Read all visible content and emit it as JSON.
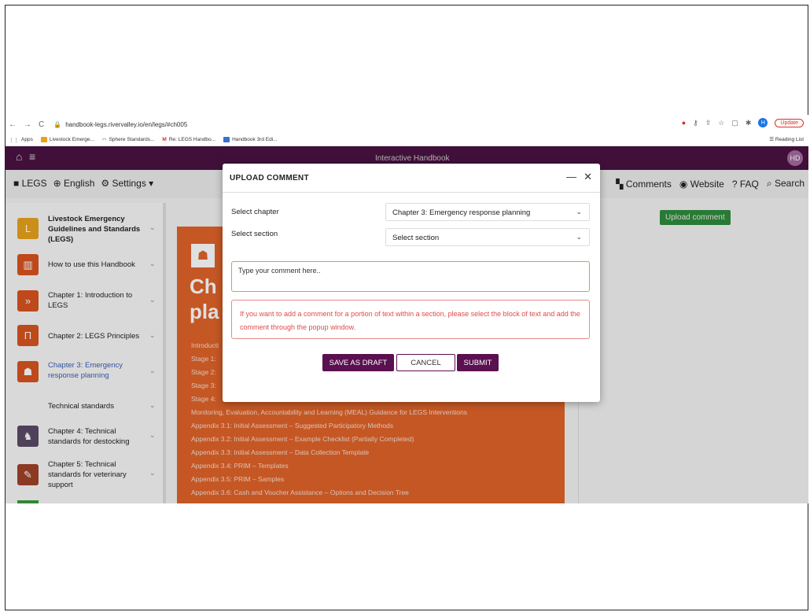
{
  "browser": {
    "url": "handbook-legs.rivervalley.io/en/legs/#ch005",
    "profile_initial": "H",
    "update_label": "Update",
    "bookmarks": [
      "Apps",
      "Livestock Emerge...",
      "Sphere Standards...",
      "Re: LEGS Handbo...",
      "Handbook 3rd Edi..."
    ],
    "reading_list": "Reading List"
  },
  "app": {
    "header_title": "Interactive Handbook",
    "user_initials": "HD",
    "toolbar_left": {
      "legs": "LEGS",
      "language": "English",
      "settings": "Settings"
    },
    "toolbar_right": {
      "comments": "Comments",
      "website": "Website",
      "faq": "FAQ",
      "search": "Search"
    },
    "upload_comment_button": "Upload comment"
  },
  "sidebar": {
    "items": [
      {
        "label": "Livestock Emergency Guidelines and Standards (LEGS)",
        "color": "#e8a21c",
        "bold": true
      },
      {
        "label": "How to use this Handbook",
        "color": "#d9541f"
      },
      {
        "label": "Chapter 1: Introduction to LEGS",
        "color": "#d9541f"
      },
      {
        "label": "Chapter 2: LEGS Principles",
        "color": "#d9541f"
      },
      {
        "label": "Chapter 3: Emergency response planning",
        "color": "#d9541f",
        "active": true
      },
      {
        "label": "Technical standards"
      },
      {
        "label": "Chapter 4: Technical standards for destocking",
        "color": "#5a4a66"
      },
      {
        "label": "Chapter 5: Technical standards for veterinary support",
        "color": "#a0432a"
      }
    ]
  },
  "content": {
    "heading_line1": "Ch",
    "heading_line2": "pla",
    "toc": [
      "Introducti",
      "Stage 1: ",
      "Stage 2: ",
      "Stage 3: ",
      "Stage 4: ",
      "Monitoring, Evaluation, Accountability and Learning (MEAL) Guidance for LEGS Interventions",
      "Appendix 3.1: Initial Assessment – Suggested Participatory Methods",
      "Appendix 3.2: Initial Assessment – Example Checklist (Partially Completed)",
      "Appendix 3.3: Initial Assessment – Data Collection Template",
      "Appendix 3.4: PRIM – Templates",
      "Appendix 3.5: PRIM – Samples",
      "Appendix 3.6: Cash and Voucher Assistance – Options and Decision Tree"
    ]
  },
  "modal": {
    "title": "UPLOAD COMMENT",
    "chapter_label": "Select chapter",
    "chapter_value": "Chapter 3: Emergency response planning",
    "section_label": "Select section",
    "section_value": "Select section",
    "comment_placeholder": "Type your comment here..",
    "alert_text": "If you want to add a comment for a portion of text within a section, please select the block of text and add the comment through the popup window.",
    "save_draft": "SAVE AS DRAFT",
    "cancel": "CANCEL",
    "submit": "SUBMIT"
  }
}
